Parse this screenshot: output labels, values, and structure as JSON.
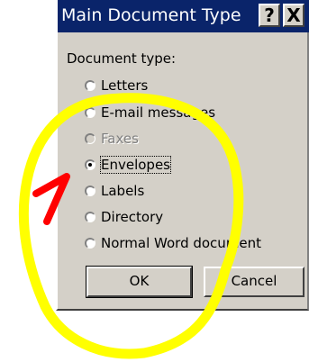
{
  "dialog": {
    "title": "Main Document Type",
    "help_label": "?",
    "close_label": "X",
    "group_label": "Document type:",
    "options": [
      {
        "label": "Letters",
        "checked": false,
        "disabled": false
      },
      {
        "label": "E-mail messages",
        "checked": false,
        "disabled": false
      },
      {
        "label": "Faxes",
        "checked": false,
        "disabled": true
      },
      {
        "label": "Envelopes",
        "checked": true,
        "disabled": false
      },
      {
        "label": "Labels",
        "checked": false,
        "disabled": false
      },
      {
        "label": "Directory",
        "checked": false,
        "disabled": false
      },
      {
        "label": "Normal Word document",
        "checked": false,
        "disabled": false
      }
    ],
    "ok_label": "OK",
    "cancel_label": "Cancel"
  },
  "colors": {
    "dialog_face": "#d4d0c8",
    "titlebar": "#0a246a",
    "highlight_circle": "#ffff00",
    "annotation_arrow": "#ff0000"
  }
}
